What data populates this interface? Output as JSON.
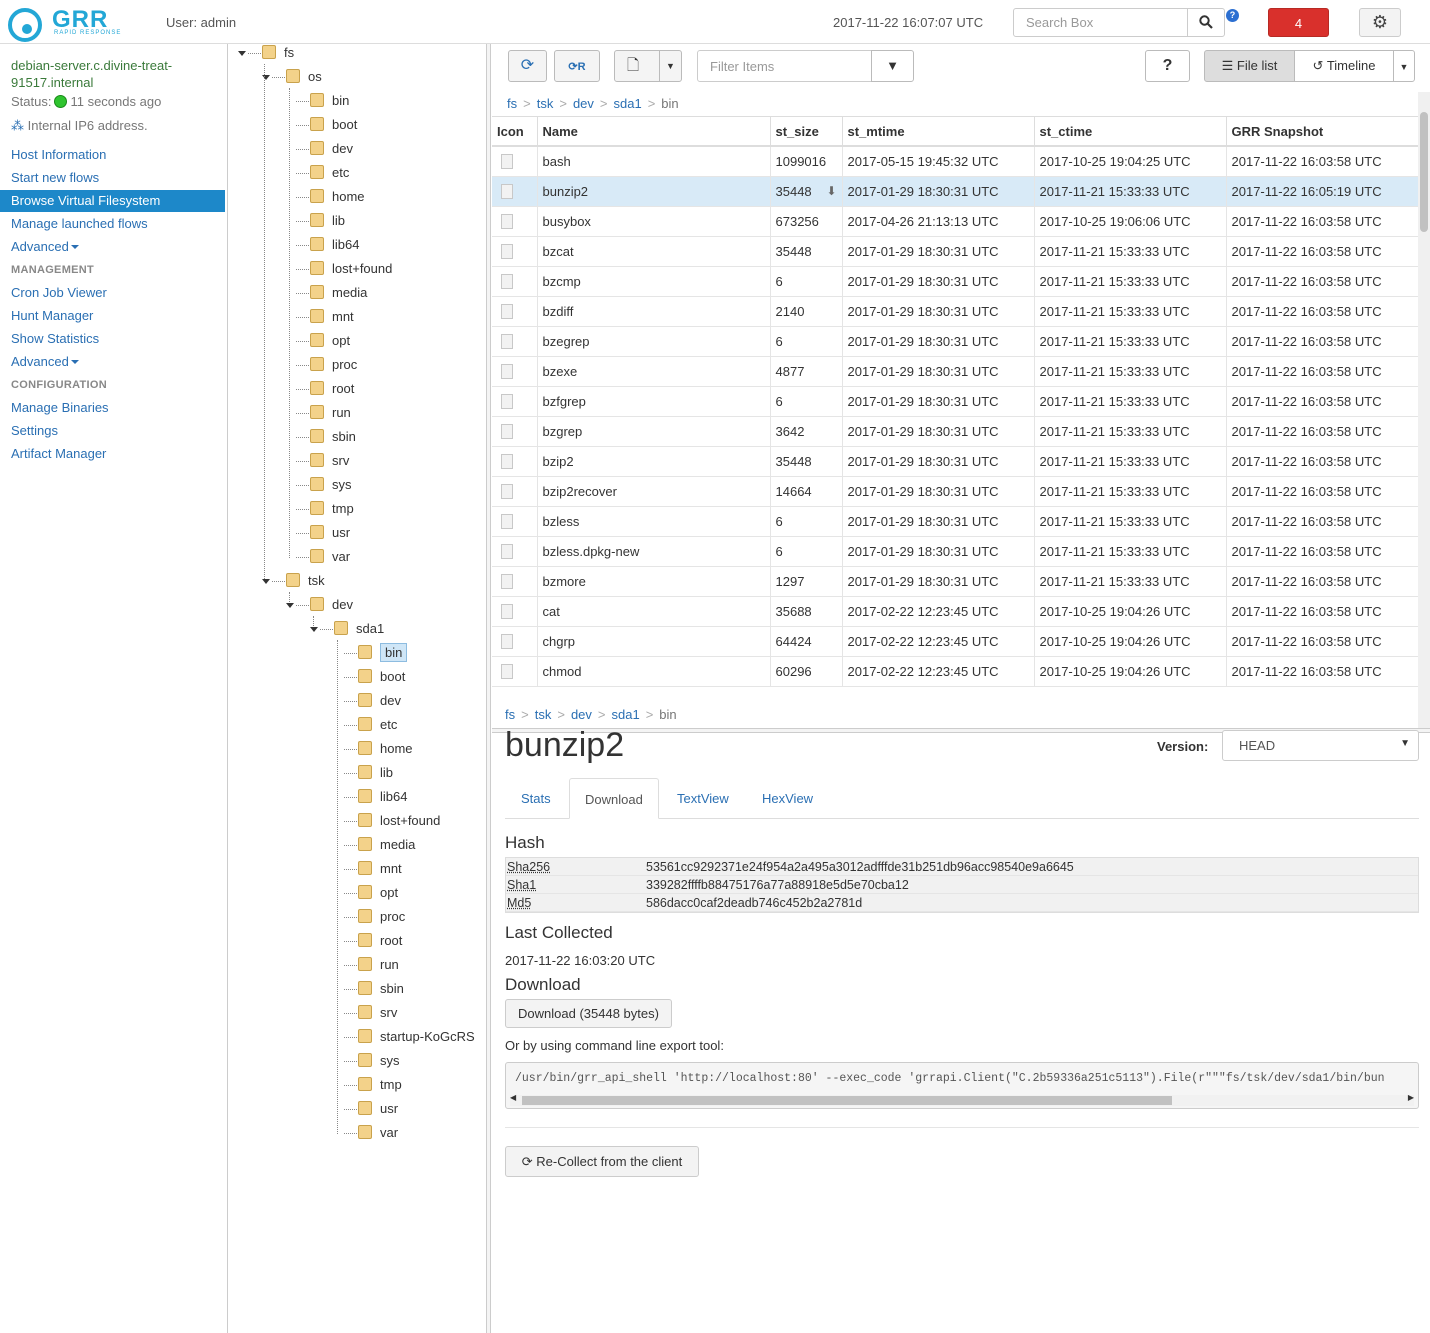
{
  "header": {
    "logo_text": "GRR",
    "logo_sub": "RAPID RESPONSE",
    "user": "User: admin",
    "clock": "2017-11-22 16:07:07 UTC",
    "search_placeholder": "Search Box",
    "notifications": "4"
  },
  "client": {
    "name": "debian-server.c.divine-treat-91517.internal",
    "status_label": "Status:",
    "status_time": "11 seconds ago",
    "ip": "Internal IP6 address."
  },
  "nav": {
    "host_info": "Host Information",
    "start_flows": "Start new flows",
    "browse_vfs": "Browse Virtual Filesystem",
    "manage_flows": "Manage launched flows",
    "advanced1": "Advanced",
    "management": "MANAGEMENT",
    "cron": "Cron Job Viewer",
    "hunt": "Hunt Manager",
    "stats": "Show Statistics",
    "advanced2": "Advanced",
    "configuration": "CONFIGURATION",
    "binaries": "Manage Binaries",
    "settings": "Settings",
    "artifacts": "Artifact Manager"
  },
  "tree": {
    "fs": "fs",
    "os": "os",
    "os_children": [
      "bin",
      "boot",
      "dev",
      "etc",
      "home",
      "lib",
      "lib64",
      "lost+found",
      "media",
      "mnt",
      "opt",
      "proc",
      "root",
      "run",
      "sbin",
      "srv",
      "sys",
      "tmp",
      "usr",
      "var"
    ],
    "tsk": "tsk",
    "dev": "dev",
    "sda1": "sda1",
    "sda1_children": [
      "bin",
      "boot",
      "dev",
      "etc",
      "home",
      "lib",
      "lib64",
      "lost+found",
      "media",
      "mnt",
      "opt",
      "proc",
      "root",
      "run",
      "sbin",
      "srv",
      "startup-KoGcRS",
      "sys",
      "tmp",
      "usr",
      "var"
    ]
  },
  "toolbar": {
    "filter_placeholder": "Filter Items",
    "file_list": "File list",
    "timeline": "Timeline"
  },
  "breadcrumb": [
    "fs",
    "tsk",
    "dev",
    "sda1",
    "bin"
  ],
  "table": {
    "headers": [
      "Icon",
      "Name",
      "st_size",
      "st_mtime",
      "st_ctime",
      "GRR Snapshot"
    ],
    "rows": [
      [
        "bash",
        "1099016",
        "2017-05-15 19:45:32 UTC",
        "2017-10-25 19:04:25 UTC",
        "2017-11-22 16:03:58 UTC"
      ],
      [
        "bunzip2",
        "35448",
        "2017-01-29 18:30:31 UTC",
        "2017-11-21 15:33:33 UTC",
        "2017-11-22 16:05:19 UTC"
      ],
      [
        "busybox",
        "673256",
        "2017-04-26 21:13:13 UTC",
        "2017-10-25 19:06:06 UTC",
        "2017-11-22 16:03:58 UTC"
      ],
      [
        "bzcat",
        "35448",
        "2017-01-29 18:30:31 UTC",
        "2017-11-21 15:33:33 UTC",
        "2017-11-22 16:03:58 UTC"
      ],
      [
        "bzcmp",
        "6",
        "2017-01-29 18:30:31 UTC",
        "2017-11-21 15:33:33 UTC",
        "2017-11-22 16:03:58 UTC"
      ],
      [
        "bzdiff",
        "2140",
        "2017-01-29 18:30:31 UTC",
        "2017-11-21 15:33:33 UTC",
        "2017-11-22 16:03:58 UTC"
      ],
      [
        "bzegrep",
        "6",
        "2017-01-29 18:30:31 UTC",
        "2017-11-21 15:33:33 UTC",
        "2017-11-22 16:03:58 UTC"
      ],
      [
        "bzexe",
        "4877",
        "2017-01-29 18:30:31 UTC",
        "2017-11-21 15:33:33 UTC",
        "2017-11-22 16:03:58 UTC"
      ],
      [
        "bzfgrep",
        "6",
        "2017-01-29 18:30:31 UTC",
        "2017-11-21 15:33:33 UTC",
        "2017-11-22 16:03:58 UTC"
      ],
      [
        "bzgrep",
        "3642",
        "2017-01-29 18:30:31 UTC",
        "2017-11-21 15:33:33 UTC",
        "2017-11-22 16:03:58 UTC"
      ],
      [
        "bzip2",
        "35448",
        "2017-01-29 18:30:31 UTC",
        "2017-11-21 15:33:33 UTC",
        "2017-11-22 16:03:58 UTC"
      ],
      [
        "bzip2recover",
        "14664",
        "2017-01-29 18:30:31 UTC",
        "2017-11-21 15:33:33 UTC",
        "2017-11-22 16:03:58 UTC"
      ],
      [
        "bzless",
        "6",
        "2017-01-29 18:30:31 UTC",
        "2017-11-21 15:33:33 UTC",
        "2017-11-22 16:03:58 UTC"
      ],
      [
        "bzless.dpkg-new",
        "6",
        "2017-01-29 18:30:31 UTC",
        "2017-11-21 15:33:33 UTC",
        "2017-11-22 16:03:58 UTC"
      ],
      [
        "bzmore",
        "1297",
        "2017-01-29 18:30:31 UTC",
        "2017-11-21 15:33:33 UTC",
        "2017-11-22 16:03:58 UTC"
      ],
      [
        "cat",
        "35688",
        "2017-02-22 12:23:45 UTC",
        "2017-10-25 19:04:26 UTC",
        "2017-11-22 16:03:58 UTC"
      ],
      [
        "chgrp",
        "64424",
        "2017-02-22 12:23:45 UTC",
        "2017-10-25 19:04:26 UTC",
        "2017-11-22 16:03:58 UTC"
      ],
      [
        "chmod",
        "60296",
        "2017-02-22 12:23:45 UTC",
        "2017-10-25 19:04:26 UTC",
        "2017-11-22 16:03:58 UTC"
      ]
    ],
    "selected_index": 1
  },
  "details": {
    "title": "bunzip2",
    "version_label": "Version:",
    "version_value": "HEAD",
    "tabs": [
      "Stats",
      "Download",
      "TextView",
      "HexView"
    ],
    "active_tab": "Download",
    "hash_title": "Hash",
    "hashes": [
      {
        "k": "Sha256",
        "v": "53561cc9292371e24f954a2a495a3012adfffde31b251db96acc98540e9a6645"
      },
      {
        "k": "Sha1",
        "v": "339282ffffb88475176a77a88918e5d5e70cba12"
      },
      {
        "k": "Md5",
        "v": "586dacc0caf2deadb746c452b2a2781d"
      }
    ],
    "last_collected_title": "Last Collected",
    "last_collected_value": "2017-11-22 16:03:20 UTC",
    "download_title": "Download",
    "download_button": "Download (35448 bytes)",
    "cli_label": "Or by using command line export tool:",
    "cli_command": "/usr/bin/grr_api_shell 'http://localhost:80' --exec_code 'grrapi.Client(\"C.2b59336a251c5113\").File(r\"\"\"fs/tsk/dev/sda1/bin/bun",
    "recollect_button": "Re-Collect from the client"
  }
}
